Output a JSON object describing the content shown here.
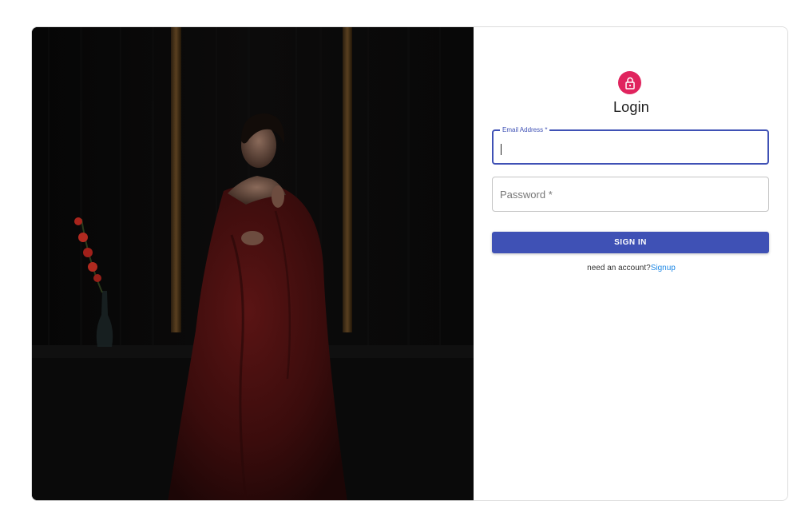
{
  "login": {
    "title": "Login",
    "lock_icon": "lock-icon",
    "accent_color": "#e0245e",
    "email": {
      "label": "Email Address *",
      "value": ""
    },
    "password": {
      "placeholder": "Password *",
      "value": ""
    },
    "signin_label": "SIGN IN",
    "signin_color": "#3f51b5",
    "signup_prompt": "need an account?",
    "signup_link": "Signup"
  }
}
